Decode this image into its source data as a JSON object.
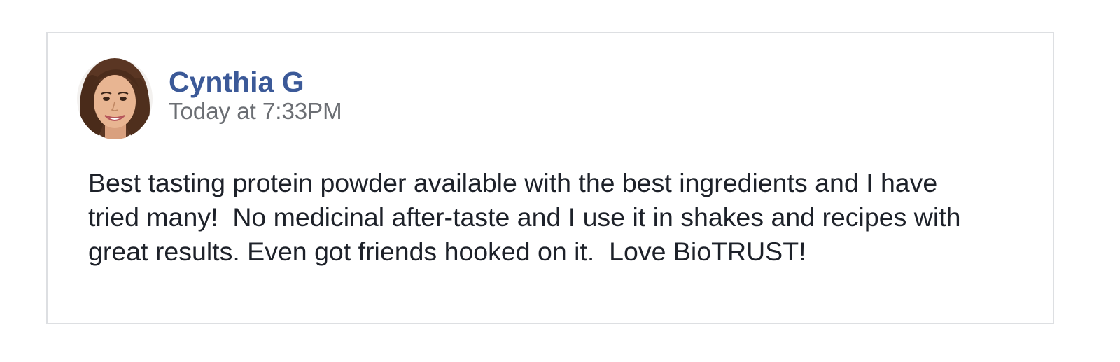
{
  "review": {
    "author_name": "Cynthia G",
    "timestamp": "Today at 7:33PM",
    "text_lines": [
      "Best tasting protein powder available with the best ingredients and I have",
      "tried many!  No medicinal after-taste and I use it in shakes and recipes with",
      "great results. Even got friends hooked on it.  Love BioTRUST!"
    ]
  },
  "colors": {
    "author_name": "#3b5998",
    "timestamp": "#6b6e73",
    "body_text": "#1d2129",
    "card_border": "#dddfe2"
  },
  "icons": {
    "avatar": "user-profile-photo"
  }
}
